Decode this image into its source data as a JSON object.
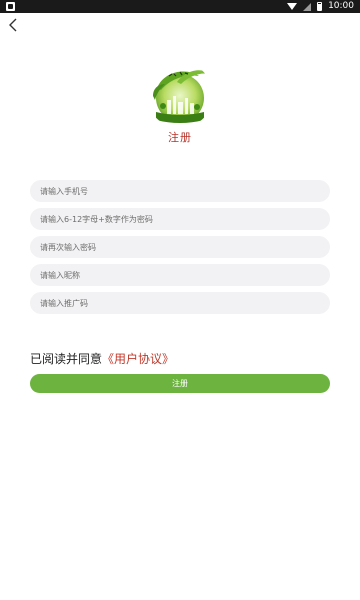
{
  "status_bar": {
    "time": "10:00",
    "icons": [
      "app-notification-icon",
      "wifi-icon",
      "signal-icon",
      "battery-icon"
    ]
  },
  "nav": {
    "back_icon": "chevron-left-icon"
  },
  "logo": {
    "icon": "green-eco-logo"
  },
  "page": {
    "title": "注册"
  },
  "form": {
    "phone_placeholder": "请输入手机号",
    "password_placeholder": "请输入6-12字母+数字作为密码",
    "password_confirm_placeholder": "请再次输入密码",
    "nickname_placeholder": "请输入昵称",
    "referral_placeholder": "请输入推广码"
  },
  "agreement": {
    "prefix": "已阅读并同意",
    "link": "《用户协议》"
  },
  "actions": {
    "register_label": "注册"
  },
  "colors": {
    "accent_green": "#6db33f",
    "title_red": "#b5332a",
    "link_red": "#c0392b",
    "field_bg": "#f2f2f4"
  }
}
